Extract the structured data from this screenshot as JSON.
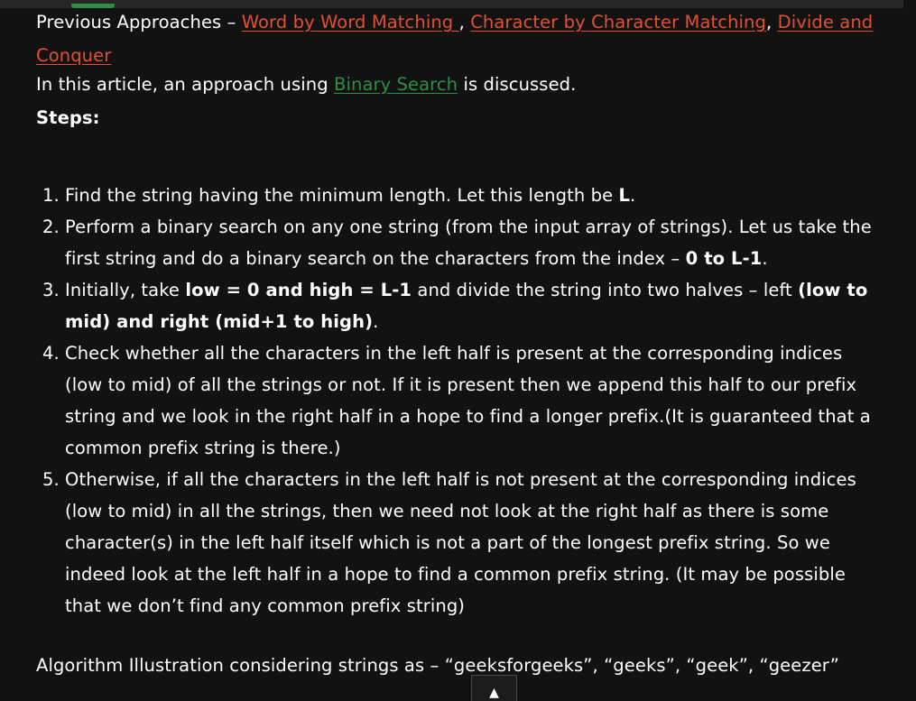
{
  "approaches": {
    "prefix": "Previous Approaches – ",
    "link_word": "Word by Word Matching ",
    "sep1": ", ",
    "link_char": "Character by Character Matching",
    "sep2": ", ",
    "link_divide_1": "Divide and",
    "link_divide_2": "Conquer "
  },
  "intro": {
    "before": "In this article, an approach using ",
    "link": "Binary Search",
    "after": " is discussed."
  },
  "steps_heading": "Steps:",
  "steps": [
    {
      "num": "1.",
      "t1": "Find the string having the minimum length. Let this length be ",
      "b1": "L",
      "t2": "."
    },
    {
      "num": "2.",
      "t1": "Perform a binary search on any one string (from the input array of strings). Let us take the first string and do a binary search on the characters from the index – ",
      "b1": "0 to L-1",
      "t2": "."
    },
    {
      "num": "3.",
      "t1": "Initially, take ",
      "b1": "low = 0 and high = L-1",
      "t2": " and divide the string into two halves – left ",
      "b2": "(low to mid) and right (mid+1 to high)",
      "t3": "."
    },
    {
      "num": "4.",
      "t1": "Check whether all the characters in the left half is present at the corresponding indices (low to mid) of all the strings or not. If it is present then we append this half to our prefix string and we look in the right half in a hope to find a longer prefix.(It is guaranteed that a common prefix string is there.)"
    },
    {
      "num": "5.",
      "t1": "Otherwise, if all the characters in the left half is not present at the corresponding indices (low to mid) in all the strings, then we need not look at the right half as there is some character(s) in the left half itself which is not a part of the longest prefix string. So we indeed look at the left half in a hope to find a common prefix string. (It may be possible that we don’t find any common prefix string)"
    }
  ],
  "illustration": "Algorithm Illustration considering strings as – “geeksforgeeks”, “geeks”, “geek”, “geezer”",
  "scroll_top_icon": "▲",
  "colors": {
    "background": "#121212",
    "link_red": "#e4502f",
    "link_green": "#2f8d46"
  }
}
